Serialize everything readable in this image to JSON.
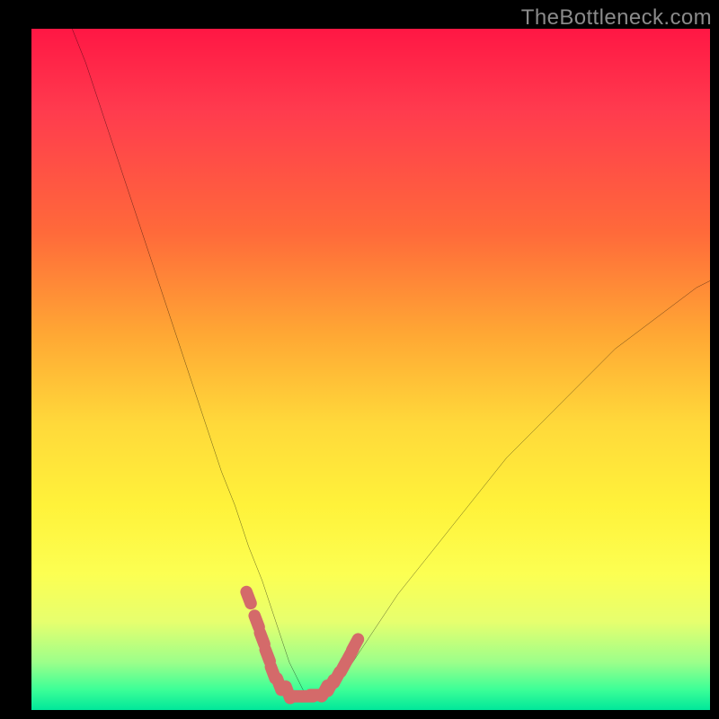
{
  "watermark": "TheBottleneck.com",
  "colors": {
    "page_bg": "#000000",
    "curve": "#000000",
    "marker": "#d46a6a",
    "gradient_top": "#ff1744",
    "gradient_bottom": "#00e79a"
  },
  "chart_data": {
    "type": "line",
    "title": "",
    "xlabel": "",
    "ylabel": "",
    "xlim": [
      0,
      100
    ],
    "ylim": [
      0,
      100
    ],
    "x": [
      6,
      8,
      10,
      12,
      14,
      16,
      18,
      20,
      22,
      24,
      26,
      28,
      30,
      32,
      34,
      36,
      37,
      38,
      39,
      40,
      41,
      42,
      43,
      44,
      46,
      48,
      50,
      54,
      58,
      62,
      66,
      70,
      74,
      78,
      82,
      86,
      90,
      94,
      98,
      100
    ],
    "values": [
      100,
      95,
      89,
      83,
      77,
      71,
      65,
      59,
      53,
      47,
      41,
      35,
      30,
      24,
      19,
      13,
      10,
      7,
      5,
      3,
      2,
      2,
      2,
      3,
      5,
      8,
      11,
      17,
      22,
      27,
      32,
      37,
      41,
      45,
      49,
      53,
      56,
      59,
      62,
      63
    ],
    "markers": [
      {
        "x": 32.0,
        "y": 16.5
      },
      {
        "x": 33.2,
        "y": 13.0
      },
      {
        "x": 34.0,
        "y": 10.5
      },
      {
        "x": 34.8,
        "y": 8.0
      },
      {
        "x": 35.6,
        "y": 5.5
      },
      {
        "x": 36.5,
        "y": 3.8
      },
      {
        "x": 37.8,
        "y": 2.6
      },
      {
        "x": 39.2,
        "y": 2.0
      },
      {
        "x": 40.6,
        "y": 2.0
      },
      {
        "x": 42.0,
        "y": 2.2
      },
      {
        "x": 43.2,
        "y": 2.8
      },
      {
        "x": 44.1,
        "y": 3.6
      },
      {
        "x": 45.0,
        "y": 4.8
      },
      {
        "x": 46.0,
        "y": 6.4
      },
      {
        "x": 47.0,
        "y": 8.2
      },
      {
        "x": 47.7,
        "y": 9.6
      }
    ]
  }
}
